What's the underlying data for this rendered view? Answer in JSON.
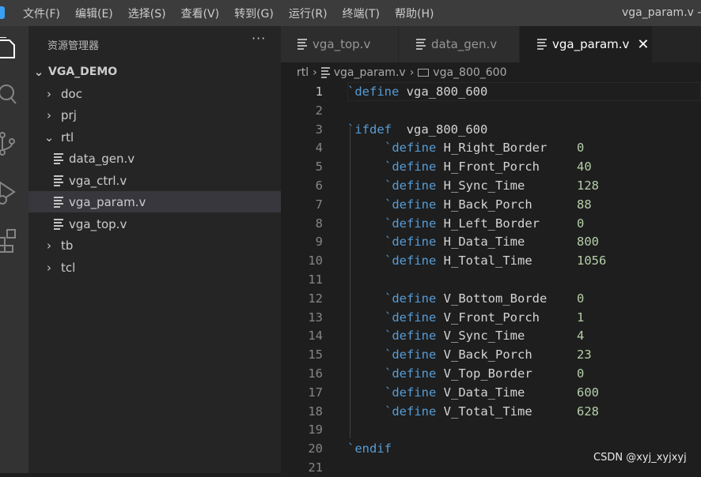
{
  "titlebar": {
    "menu": [
      "文件(F)",
      "编辑(E)",
      "选择(S)",
      "查看(V)",
      "转到(G)",
      "运行(R)",
      "终端(T)",
      "帮助(H)"
    ],
    "window_title": "vga_param.v - v"
  },
  "activity_bar": {
    "icons": [
      "explorer-icon",
      "search-icon",
      "source-control-icon",
      "run-debug-icon",
      "extensions-icon"
    ]
  },
  "sidebar": {
    "title": "资源管理器",
    "more": "···",
    "project": "VGA_DEMO",
    "tree": [
      {
        "label": "doc",
        "type": "folder",
        "expanded": false
      },
      {
        "label": "prj",
        "type": "folder",
        "expanded": false
      },
      {
        "label": "rtl",
        "type": "folder",
        "expanded": true
      },
      {
        "label": "data_gen.v",
        "type": "file"
      },
      {
        "label": "vga_ctrl.v",
        "type": "file"
      },
      {
        "label": "vga_param.v",
        "type": "file",
        "active": true
      },
      {
        "label": "vga_top.v",
        "type": "file"
      },
      {
        "label": "tb",
        "type": "folder",
        "expanded": false
      },
      {
        "label": "tcl",
        "type": "folder",
        "expanded": false
      }
    ]
  },
  "tabs": [
    {
      "label": "vga_top.v",
      "active": false
    },
    {
      "label": "data_gen.v",
      "active": false
    },
    {
      "label": "vga_param.v",
      "active": true,
      "close": "✕"
    }
  ],
  "breadcrumb": {
    "folder": "rtl",
    "file": "vga_param.v",
    "symbol": "vga_800_600"
  },
  "editor": {
    "lines": [
      {
        "n": "1",
        "kw": "`define",
        "name": "vga_800_600",
        "val": "",
        "indent": 0
      },
      {
        "n": "2",
        "kw": "",
        "name": "",
        "val": "",
        "indent": 0
      },
      {
        "n": "3",
        "kw": "`ifdef",
        "name": " vga_800_600",
        "val": "",
        "indent": 0
      },
      {
        "n": "4",
        "kw": "`define",
        "name": "H_Right_Border",
        "val": "0",
        "indent": 1
      },
      {
        "n": "5",
        "kw": "`define",
        "name": "H_Front_Porch",
        "val": "40",
        "indent": 1
      },
      {
        "n": "6",
        "kw": "`define",
        "name": "H_Sync_Time",
        "val": "128",
        "indent": 1
      },
      {
        "n": "7",
        "kw": "`define",
        "name": "H_Back_Porch",
        "val": "88",
        "indent": 1
      },
      {
        "n": "8",
        "kw": "`define",
        "name": "H_Left_Border",
        "val": "0",
        "indent": 1
      },
      {
        "n": "9",
        "kw": "`define",
        "name": "H_Data_Time",
        "val": "800",
        "indent": 1
      },
      {
        "n": "10",
        "kw": "`define",
        "name": "H_Total_Time",
        "val": "1056",
        "indent": 1
      },
      {
        "n": "11",
        "kw": "",
        "name": "",
        "val": "",
        "indent": 0
      },
      {
        "n": "12",
        "kw": "`define",
        "name": "V_Bottom_Borde",
        "val": "0",
        "indent": 1
      },
      {
        "n": "13",
        "kw": "`define",
        "name": "V_Front_Porch",
        "val": "1",
        "indent": 1
      },
      {
        "n": "14",
        "kw": "`define",
        "name": "V_Sync_Time",
        "val": "4",
        "indent": 1
      },
      {
        "n": "15",
        "kw": "`define",
        "name": "V_Back_Porch",
        "val": "23",
        "indent": 1
      },
      {
        "n": "16",
        "kw": "`define",
        "name": "V_Top_Border",
        "val": "0",
        "indent": 1
      },
      {
        "n": "17",
        "kw": "`define",
        "name": "V_Data_Time",
        "val": "600",
        "indent": 1
      },
      {
        "n": "18",
        "kw": "`define",
        "name": "V_Total_Time",
        "val": "628",
        "indent": 1
      },
      {
        "n": "19",
        "kw": "",
        "name": "",
        "val": "",
        "indent": 0
      },
      {
        "n": "20",
        "kw": "`endif",
        "name": "",
        "val": "",
        "indent": 0
      },
      {
        "n": "21",
        "kw": "",
        "name": "",
        "val": "",
        "indent": 0
      }
    ]
  },
  "watermark": "CSDN @xyj_xyjxyj",
  "colors": {
    "keyword": "#569cd6",
    "number": "#b5cea8",
    "identifier": "#d4d4d4",
    "editor_bg": "#1e1e1e"
  }
}
